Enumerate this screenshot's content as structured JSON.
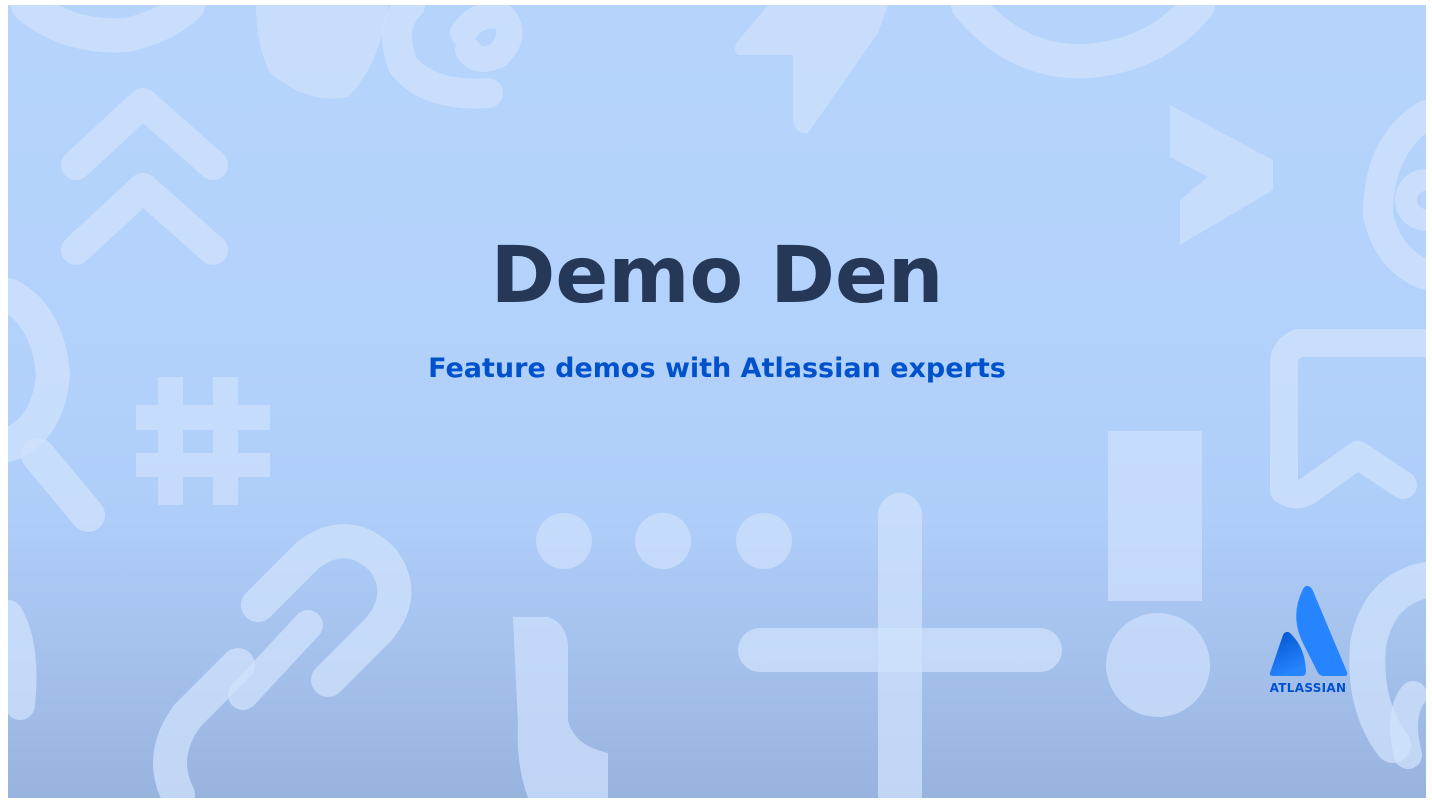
{
  "slide": {
    "title": "Demo Den",
    "subtitle": "Feature demos with Atlassian experts"
  },
  "logo": {
    "wordmark": "ATLASSIAN",
    "icon": "atlassian-logo-icon",
    "color": "#0052cc"
  },
  "background": {
    "color_top": "#b6d4fb",
    "color_bottom": "#98b3dd",
    "icon_tint": "#cfe1fc",
    "icons": [
      "chat-bubble-icon",
      "at-sign-icon",
      "lightning-bolt-icon",
      "chevron-up-double-icon",
      "search-icon",
      "hashtag-icon",
      "link-icon",
      "ellipsis-icon",
      "curly-brace-icon",
      "plus-icon",
      "exclamation-icon",
      "play-arrow-icon",
      "bookmark-icon",
      "circle-icon",
      "ring-icon"
    ]
  },
  "colors": {
    "title": "#253858",
    "subtitle": "#0052cc"
  }
}
